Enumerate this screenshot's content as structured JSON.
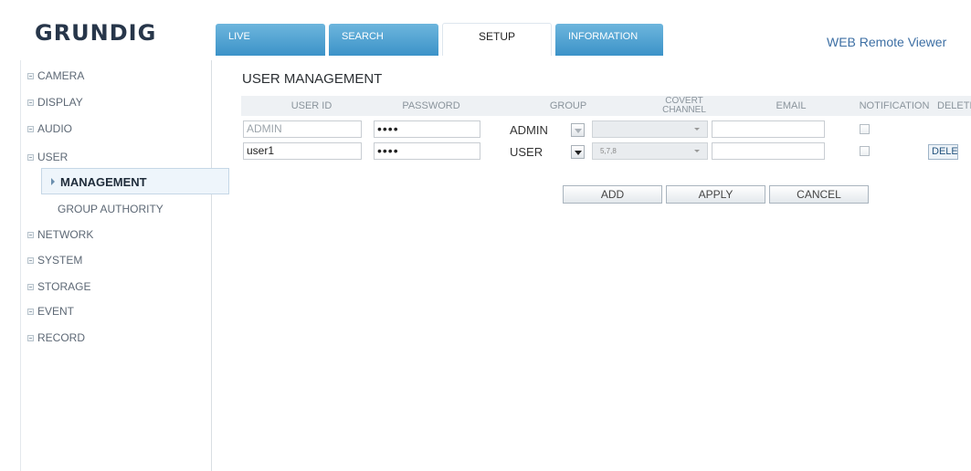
{
  "brand": "GRUNDIG",
  "tabs": [
    {
      "label": "LIVE"
    },
    {
      "label": "SEARCH"
    },
    {
      "label": "SETUP"
    },
    {
      "label": "INFORMATION"
    }
  ],
  "active_tab": "SETUP",
  "remote_title": "WEB Remote Viewer",
  "sidebar": {
    "items": [
      {
        "label": "CAMERA"
      },
      {
        "label": "DISPLAY"
      },
      {
        "label": "AUDIO"
      },
      {
        "label": "USER"
      },
      {
        "label": "NETWORK"
      },
      {
        "label": "SYSTEM"
      },
      {
        "label": "STORAGE"
      },
      {
        "label": "EVENT"
      },
      {
        "label": "RECORD"
      }
    ],
    "subitems": [
      {
        "label": "MANAGEMENT",
        "active": true
      },
      {
        "label": "GROUP AUTHORITY",
        "active": false
      }
    ]
  },
  "main": {
    "title": "USER MANAGEMENT",
    "columns": {
      "user_id": "USER ID",
      "password": "PASSWORD",
      "group": "GROUP",
      "covert_line1": "COVERT",
      "covert_line2": "CHANNEL",
      "email": "EMAIL",
      "notification": "NOTIFICATION",
      "delete": "DELETE"
    },
    "rows": [
      {
        "user_id": "ADMIN",
        "password": "••••",
        "group": "ADMIN",
        "covert": "",
        "email": "",
        "notification": false
      },
      {
        "user_id": "user1",
        "password": "••••",
        "group": "USER",
        "covert": "5,7,8",
        "email": "",
        "notification": false,
        "delete_label": "DELETE"
      }
    ],
    "buttons": {
      "add": "ADD",
      "apply": "APPLY",
      "cancel": "CANCEL"
    }
  }
}
